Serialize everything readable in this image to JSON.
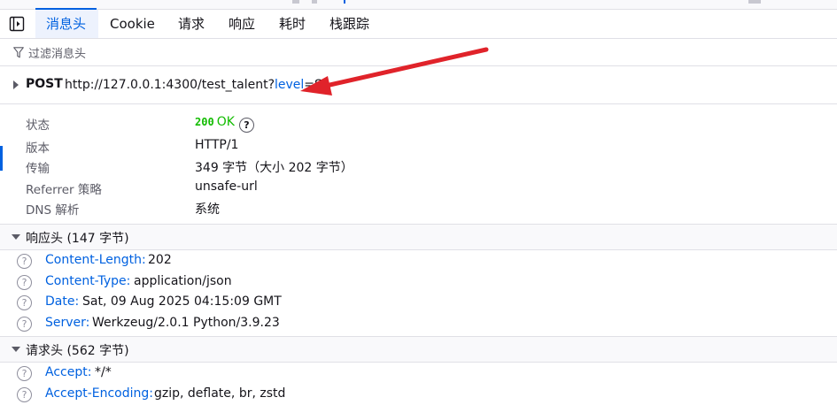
{
  "tabs": [
    {
      "label": "消息头",
      "active": true
    },
    {
      "label": "Cookie",
      "active": false
    },
    {
      "label": "请求",
      "active": false
    },
    {
      "label": "响应",
      "active": false
    },
    {
      "label": "耗时",
      "active": false
    },
    {
      "label": "栈跟踪",
      "active": false
    }
  ],
  "filter": {
    "placeholder": "过滤消息头"
  },
  "request": {
    "method": "POST",
    "url_base": "http://127.0.0.1:4300/test_talent?",
    "url_param_name": "level",
    "url_param_eq": "=",
    "url_param_value": "S"
  },
  "summary": {
    "status_label": "状态",
    "status_code": "200",
    "status_text": "OK",
    "status_help": "?",
    "version_label": "版本",
    "version_value": "HTTP/1",
    "transfer_label": "传输",
    "transfer_value": "349 字节（大小 202 字节）",
    "referrer_label": "Referrer 策略",
    "referrer_value": "unsafe-url",
    "dns_label": "DNS 解析",
    "dns_value": "系统"
  },
  "response_headers": {
    "title": "响应头 (147 字节)",
    "items": [
      {
        "name": "Content-Length:",
        "value": "202"
      },
      {
        "name": "Content-Type:",
        "value": "application/json"
      },
      {
        "name": "Date:",
        "value": "Sat, 09 Aug 2025 04:15:09 GMT"
      },
      {
        "name": "Server:",
        "value": "Werkzeug/2.0.1 Python/3.9.23"
      }
    ]
  },
  "request_headers": {
    "title": "请求头 (562 字节)",
    "items": [
      {
        "name": "Accept:",
        "value": "*/*"
      },
      {
        "name": "Accept-Encoding:",
        "value": "gzip, deflate, br, zstd"
      }
    ]
  },
  "colors": {
    "accent": "#0061e0",
    "status_ok": "#12bc00",
    "annotation_arrow": "#e0232a"
  },
  "icons": {
    "panel_toggle": "sidebar-toggle-icon",
    "filter": "funnel-icon",
    "help": "question-circle-icon",
    "annotation": "red-arrow"
  }
}
